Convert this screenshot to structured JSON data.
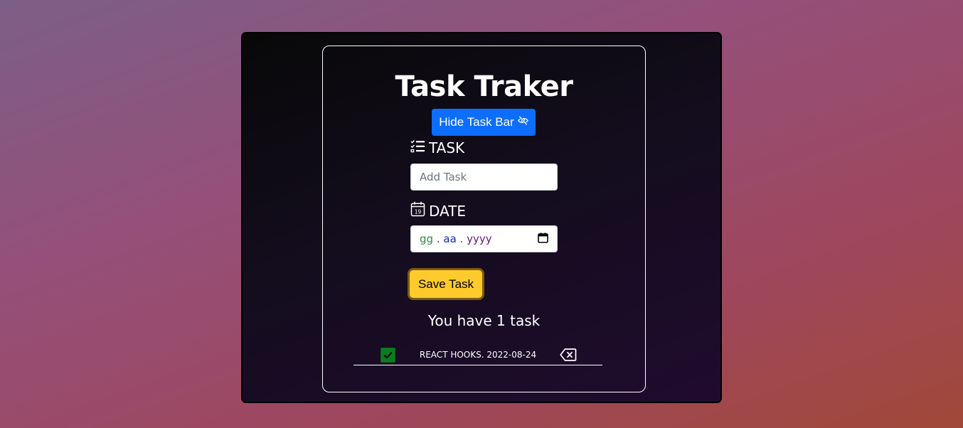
{
  "app": {
    "title": "Task Traker"
  },
  "toggle_button": {
    "label": "Hide Task Bar",
    "icon": "eye-slash-icon",
    "color": "#0d6efd"
  },
  "form": {
    "task_label": "TASK",
    "task_icon": "checklist-icon",
    "task_placeholder": "Add Task",
    "task_value": "",
    "date_label": "DATE",
    "date_icon": "calendar-icon",
    "date_placeholder": {
      "day": "gg",
      "month": "aa",
      "year": "yyyy",
      "separator": "."
    },
    "save_label": "Save Task",
    "save_color": "#ffca2c"
  },
  "summary": {
    "count_text": "You have 1 task"
  },
  "tasks": [
    {
      "completed": true,
      "text": "REACT HOOKS. 2022-08-24",
      "check_color": "#0b7d1f"
    }
  ]
}
